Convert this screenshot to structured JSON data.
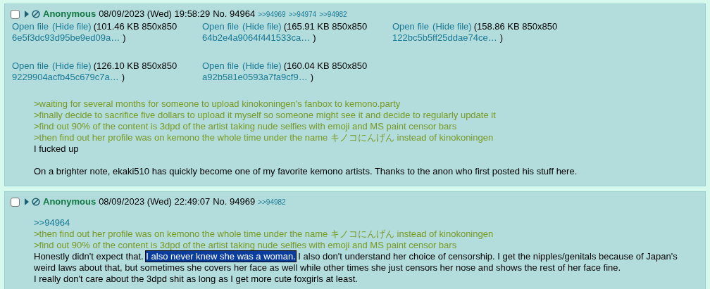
{
  "posts": [
    {
      "checked": false,
      "name": "Anonymous",
      "datetime": "08/09/2023 (Wed) 19:58:29",
      "number": "No. 94964",
      "backlinks": [
        ">>94969",
        ">>94974",
        ">>94982"
      ],
      "files": [
        {
          "open": "Open file",
          "hide": "(Hide file)",
          "info": "(101.46 KB 850x850",
          "filename": "6e5f3dc93d95be9ed09a…",
          "close": ")"
        },
        {
          "open": "Open file",
          "hide": "(Hide file)",
          "info": "(165.91 KB 850x850",
          "filename": "64b2e4a9064f441533ca…",
          "close": ")"
        },
        {
          "open": "Open file",
          "hide": "(Hide file)",
          "info": "(158.86 KB 850x850",
          "filename": "122bc5b5ff25ddae74ce…",
          "close": ")"
        },
        {
          "open": "Open file",
          "hide": "(Hide file)",
          "info": "(126.10 KB 850x850",
          "filename": "9229904acfb45c679c7a…",
          "close": ")"
        },
        {
          "open": "Open file",
          "hide": "(Hide file)",
          "info": "(160.04 KB 850x850",
          "filename": "a92b581e0593a7fa9cf9…",
          "close": ")"
        }
      ],
      "lines": [
        {
          "kind": "greentext",
          "text": ">waiting for several months for someone to upload kinokoningen's fanbox to kemono.party"
        },
        {
          "kind": "greentext",
          "text": ">finally decide to sacrifice five dollars to upload it myself so someone might see it and decide to regularly update it"
        },
        {
          "kind": "greentext",
          "text": ">find out 90% of the content is 3dpd of the artist taking nude selfies with emoji and MS paint censor bars"
        },
        {
          "kind": "greentext",
          "text": ">then find out her profile was on kemono the whole time under the name キノコにんげん instead of kinokoningen"
        },
        {
          "kind": "text",
          "parts": [
            {
              "text": "I fucked up",
              "selected": false
            }
          ]
        },
        {
          "kind": "blank"
        },
        {
          "kind": "text",
          "parts": [
            {
              "text": "On a brighter note, ekaki510 has quickly become one of my favorite kemono artists. Thanks to the anon who first posted his stuff here.",
              "selected": false
            }
          ]
        }
      ]
    },
    {
      "checked": false,
      "name": "Anonymous",
      "datetime": "08/09/2023 (Wed) 22:49:07",
      "number": "No. 94969",
      "backlinks": [
        ">>94982"
      ],
      "lines": [
        {
          "kind": "quotelink",
          "text": ">>94964"
        },
        {
          "kind": "greentext",
          "text": ">then find out her profile was on kemono the whole time under the name キノコにんげん instead of kinokoningen"
        },
        {
          "kind": "greentext",
          "text": ">find out 90% of the content is 3dpd of the artist taking nude selfies with emoji and MS paint censor bars"
        },
        {
          "kind": "text",
          "parts": [
            {
              "text": "Honestly didn't expect that. ",
              "selected": false
            },
            {
              "text": "I also never knew she was a woman.",
              "selected": true
            },
            {
              "text": " I also don't understand her choice of censorship. I get the nipples/genitals because of Japan's weird laws about that, but sometimes she covers her face as well while other times she just censors her nose and shows the rest of her face fine.",
              "selected": false
            }
          ]
        },
        {
          "kind": "text",
          "parts": [
            {
              "text": "I really don't care about the 3dpd shit as long as I get more cute foxgirls at least.",
              "selected": false
            }
          ]
        }
      ]
    }
  ]
}
